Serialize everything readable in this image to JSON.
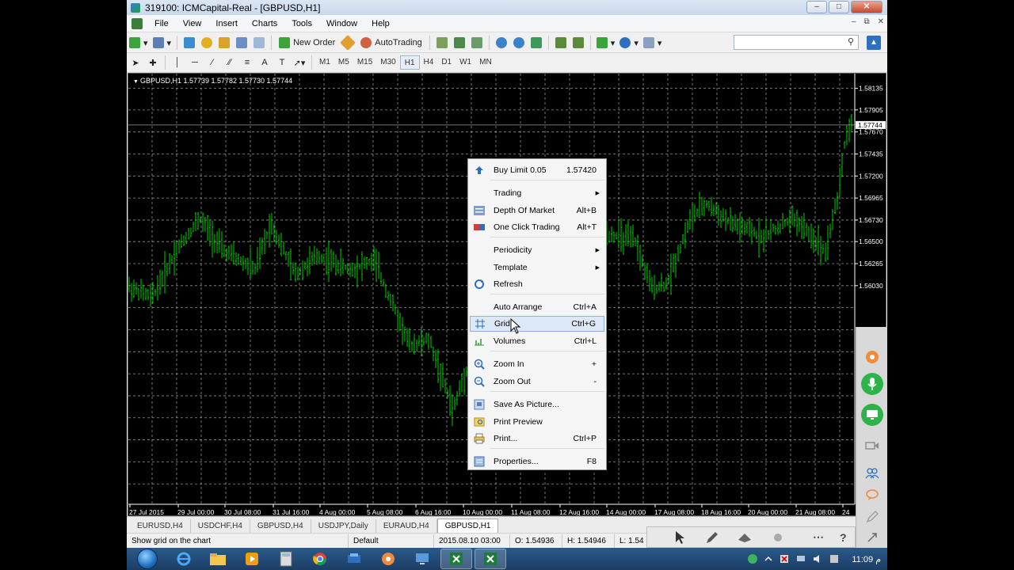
{
  "window": {
    "title": "319100: ICMCapital-Real - [GBPUSD,H1]"
  },
  "menubar": {
    "items": [
      "File",
      "View",
      "Insert",
      "Charts",
      "Tools",
      "Window",
      "Help"
    ]
  },
  "toolbar": {
    "new_order_label": "New Order",
    "autotrading_label": "AutoTrading",
    "search_placeholder": ""
  },
  "periods": {
    "items": [
      "M1",
      "M5",
      "M15",
      "M30",
      "H1",
      "H4",
      "D1",
      "W1",
      "MN"
    ],
    "active": "H1"
  },
  "chart": {
    "header": "GBPUSD,H1  1.57739 1.57782 1.57730 1.57744",
    "current_price": "1.57744",
    "price_labels": [
      "1.58135",
      "1.57905",
      "1.57670",
      "1.57435",
      "1.57200",
      "1.56965",
      "1.56730",
      "1.56500",
      "1.56265",
      "1.56030"
    ],
    "time_labels": [
      "27 Jul 2015",
      "29 Jul 00:00",
      "30 Jul 08:00",
      "31 Jul 16:00",
      "4 Aug 00:00",
      "5 Aug 08:00",
      "6 Aug 16:00",
      "10 Aug 00:00",
      "11 Aug 08:00",
      "12 Aug 16:00",
      "14 Aug 00:00",
      "17 Aug 08:00",
      "18 Aug 16:00",
      "20 Aug 00:00",
      "21 Aug 08:00",
      "24"
    ],
    "colors": {
      "bars": "#00cc00",
      "grid": "#c0c0c0",
      "background": "#000000",
      "text": "#ffffff"
    }
  },
  "context_menu": {
    "items": [
      {
        "label": "Buy Limit 0.05",
        "shortcut": "1.57420",
        "icon": "buy-limit-icon",
        "submenu": false
      },
      {
        "label": "Trading",
        "shortcut": "",
        "icon": "",
        "submenu": true
      },
      {
        "label": "Depth Of Market",
        "shortcut": "Alt+B",
        "icon": "depth-of-market-icon",
        "submenu": false
      },
      {
        "label": "One Click Trading",
        "shortcut": "Alt+T",
        "icon": "one-click-trading-icon",
        "submenu": false
      },
      {
        "label": "Periodicity",
        "shortcut": "",
        "icon": "",
        "submenu": true
      },
      {
        "label": "Template",
        "shortcut": "",
        "icon": "",
        "submenu": true
      },
      {
        "label": "Refresh",
        "shortcut": "",
        "icon": "refresh-icon",
        "submenu": false
      },
      {
        "label": "Auto Arrange",
        "shortcut": "Ctrl+A",
        "icon": "",
        "submenu": false
      },
      {
        "label": "Grid",
        "shortcut": "Ctrl+G",
        "icon": "grid-icon",
        "submenu": false,
        "highlighted": true
      },
      {
        "label": "Volumes",
        "shortcut": "Ctrl+L",
        "icon": "volumes-icon",
        "submenu": false
      },
      {
        "label": "Zoom In",
        "shortcut": "+",
        "icon": "zoom-in-icon",
        "submenu": false
      },
      {
        "label": "Zoom Out",
        "shortcut": "-",
        "icon": "zoom-out-icon",
        "submenu": false
      },
      {
        "label": "Save As Picture...",
        "shortcut": "",
        "icon": "save-picture-icon",
        "submenu": false
      },
      {
        "label": "Print Preview",
        "shortcut": "",
        "icon": "print-preview-icon",
        "submenu": false
      },
      {
        "label": "Print...",
        "shortcut": "Ctrl+P",
        "icon": "print-icon",
        "submenu": false
      },
      {
        "label": "Properties...",
        "shortcut": "F8",
        "icon": "properties-icon",
        "submenu": false
      }
    ]
  },
  "tabs": {
    "items": [
      "EURUSD,H4",
      "USDCHF,H4",
      "GBPUSD,H4",
      "USDJPY,Daily",
      "EURAUD,H4",
      "GBPUSD,H1"
    ],
    "active": "GBPUSD,H1"
  },
  "status": {
    "hint": "Show grid on the chart",
    "profile": "Default",
    "datetime": "2015.08.10 03:00",
    "open": "O: 1.54936",
    "high": "H: 1.54946",
    "low": "L: 1.54"
  },
  "taskbar": {
    "clock": "11:09 م"
  }
}
